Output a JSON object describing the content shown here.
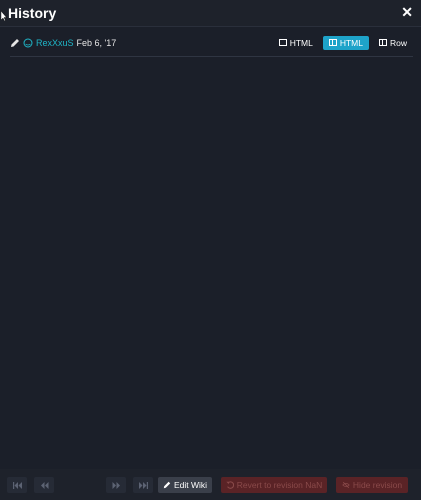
{
  "header": {
    "title": "History",
    "close_icon": "close-icon"
  },
  "revision": {
    "author": "RexXxuS",
    "date": "Feb 6, '17"
  },
  "view_toggles": [
    {
      "label": "HTML",
      "icon": "square-icon",
      "active": false
    },
    {
      "label": "HTML",
      "icon": "split-view-icon",
      "active": true
    },
    {
      "label": "Row",
      "icon": "columns-icon",
      "active": false
    }
  ],
  "footer": {
    "edit_label": "Edit Wiki",
    "revert_label": "Revert to revision NaN",
    "hide_label": "Hide revision"
  },
  "colors": {
    "background": "#1b1f29",
    "accent": "#1ea3c9",
    "author": "#1fb6c8",
    "danger": "#5a2326"
  }
}
